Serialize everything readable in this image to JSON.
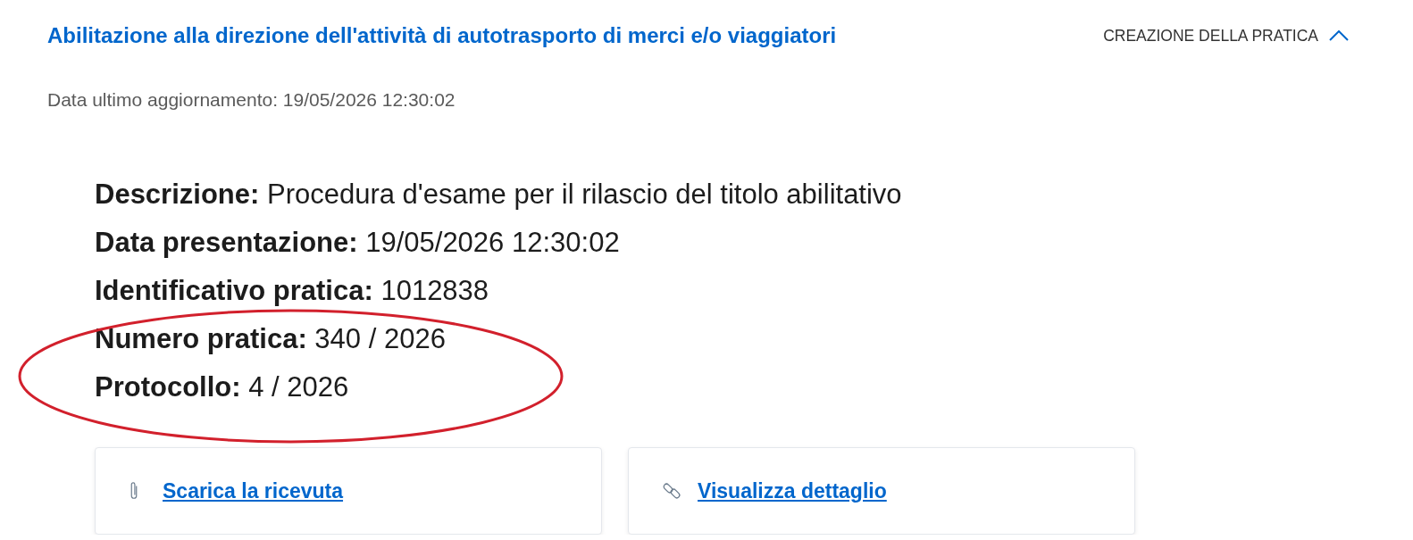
{
  "header": {
    "title": "Abilitazione alla direzione dell'attività di autotrasporto di merci e/o viaggiatori",
    "status": {
      "label": "CREAZIONE DELLA PRATICA",
      "expanded": true
    }
  },
  "last_update": "Data ultimo aggiornamento: 19/05/2026 12:30:02",
  "details": [
    {
      "label": "Descrizione:",
      "value": "Procedura d'esame per il rilascio del titolo abilitativo"
    },
    {
      "label": "Data presentazione:",
      "value": "19/05/2026 12:30:02"
    },
    {
      "label": "Identificativo pratica:",
      "value": "1012838"
    },
    {
      "label": "Numero pratica:",
      "value": "340 / 2026"
    },
    {
      "label": "Protocollo:",
      "value": "4 / 2026"
    }
  ],
  "annotations": [
    {
      "kind": "ellipse"
    }
  ],
  "actions": [
    {
      "kind": "attachment",
      "label": "Scarica la ricevuta"
    },
    {
      "kind": "link",
      "label": "Visualizza dettaglio"
    }
  ]
}
